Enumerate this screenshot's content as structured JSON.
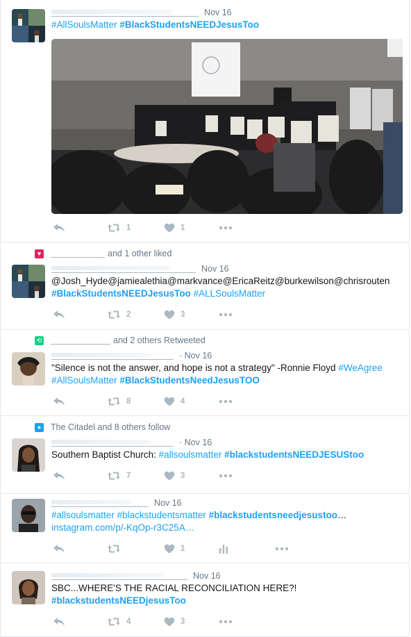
{
  "tweets": [
    {
      "date": "Nov 16",
      "text_parts": [
        {
          "t": "#AllSoulsMatter",
          "kind": "tag"
        },
        {
          "t": " ",
          "kind": "plain"
        },
        {
          "t": "#BlackStudentsNEEDJesusToo",
          "kind": "tagb"
        }
      ],
      "line2": [],
      "media": "conference-room-photo",
      "reply_icon": "reply-icon",
      "retweets": "1",
      "likes": "1"
    },
    {
      "context_icon": "heart-icon",
      "context_text": "and 1 other liked",
      "date": "Nov 16",
      "text_parts": [
        {
          "t": "@Josh_Hyde@jamiealethia@markvance@EricaReitz@burkewilson@chrisrouten",
          "kind": "plain"
        }
      ],
      "line2": [
        {
          "t": "#BlackStudentsNEEDJesusToo",
          "kind": "tagb"
        },
        {
          "t": " ",
          "kind": "plain"
        },
        {
          "t": "#ALLSoulsMatter",
          "kind": "tag"
        }
      ],
      "retweets": "2",
      "likes": "3"
    },
    {
      "context_icon": "retweet-icon",
      "context_text": "and 2 others Retweeted",
      "date": "· Nov 16",
      "text_parts": [
        {
          "t": "\"Silence is not the answer, and hope is not a strategy\" -Ronnie Floyd ",
          "kind": "plain"
        },
        {
          "t": "#WeAgree",
          "kind": "tag"
        }
      ],
      "line2": [
        {
          "t": "#AllSoulsMatter",
          "kind": "tag"
        },
        {
          "t": " ",
          "kind": "plain"
        },
        {
          "t": "#BlackStudentsNeedJesusTOO",
          "kind": "tagb"
        }
      ],
      "retweets": "8",
      "likes": "4"
    },
    {
      "context_icon": "follow-icon",
      "context_text": "The Citadel and 8 others follow",
      "date": "· Nov 16",
      "text_parts": [
        {
          "t": "Southern Baptist Church: ",
          "kind": "plain"
        },
        {
          "t": "#allsoulsmatter",
          "kind": "tag"
        },
        {
          "t": " ",
          "kind": "plain"
        },
        {
          "t": "#blackstudentsNEEDJESUStoo",
          "kind": "tagb"
        }
      ],
      "line2": [],
      "retweets": "7",
      "likes": "3"
    },
    {
      "date": "Nov 16",
      "text_parts": [
        {
          "t": "#allsoulsmatter",
          "kind": "tag"
        },
        {
          "t": " ",
          "kind": "plain"
        },
        {
          "t": "#blackstudentsmatter",
          "kind": "tag"
        },
        {
          "t": " ",
          "kind": "plain"
        },
        {
          "t": "#blackstudentsneedjesustoo",
          "kind": "tagb"
        },
        {
          "t": "…",
          "kind": "plain"
        }
      ],
      "line2": [
        {
          "t": "instagram.com/p/-KqOp-r3C25A…",
          "kind": "tag"
        }
      ],
      "retweets": "",
      "likes": "1"
    },
    {
      "date": "Nov 16",
      "text_parts": [
        {
          "t": "SBC...WHERE'S THE RACIAL RECONCILIATION HERE?!",
          "kind": "plain"
        }
      ],
      "line2": [
        {
          "t": "#blackstudentsNEEDjesusToo",
          "kind": "tagb"
        }
      ],
      "retweets": "4",
      "likes": "3"
    }
  ],
  "colors": {
    "link": "#1da1f2",
    "muted": "#657786",
    "icon": "#aab8c2",
    "like_context": "#e0245e",
    "retweet_context": "#19cf86",
    "follow_context": "#1da1f2"
  }
}
